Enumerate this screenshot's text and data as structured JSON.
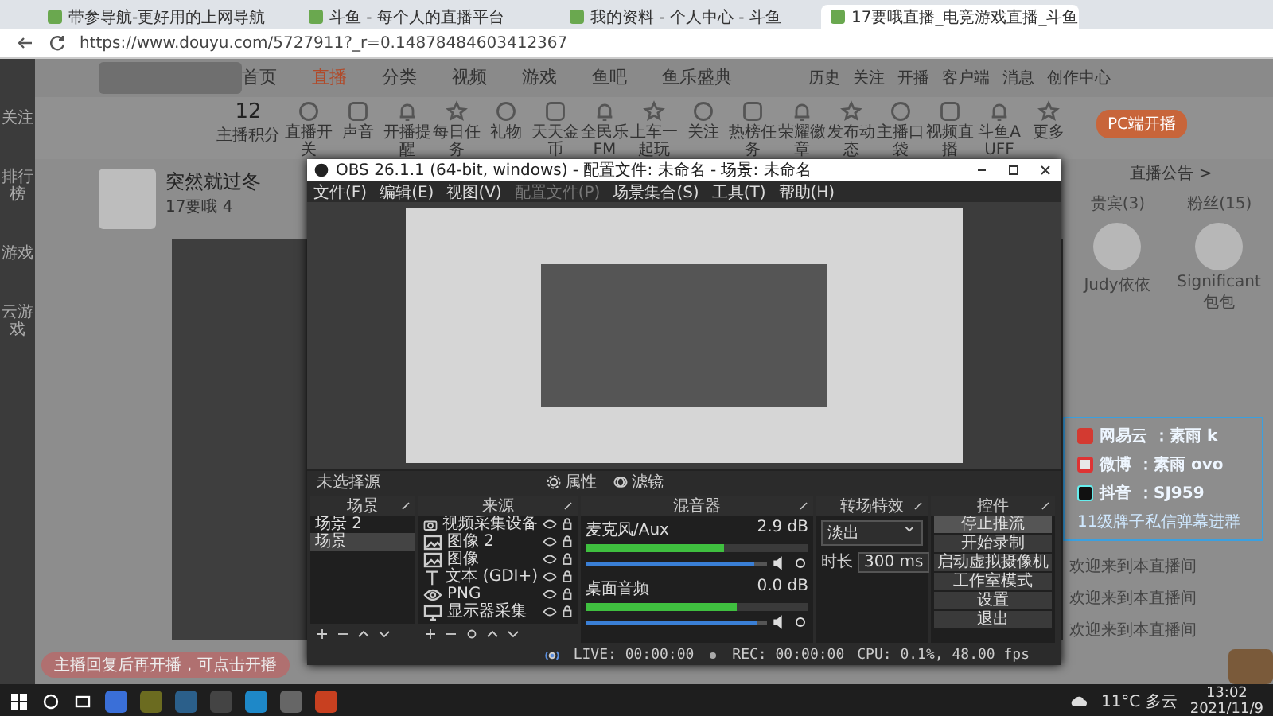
{
  "browser": {
    "tabs": [
      {
        "title": "带参导航-更好用的上网导航",
        "selected": false
      },
      {
        "title": "斗鱼 - 每个人的直播平台",
        "selected": false
      },
      {
        "title": "我的资料 - 个人中心 - 斗鱼",
        "selected": false
      },
      {
        "title": "17要哦直播_电竞游戏直播_斗鱼",
        "selected": true
      }
    ],
    "url": "https://www.douyu.com/5727911?_r=0.14878484603412367"
  },
  "site": {
    "nav": [
      {
        "label": "首页",
        "selected": false
      },
      {
        "label": "直播",
        "selected": true
      },
      {
        "label": "分类",
        "selected": false
      },
      {
        "label": "视频",
        "selected": false
      },
      {
        "label": "游戏",
        "selected": false
      },
      {
        "label": "鱼吧",
        "selected": false
      },
      {
        "label": "鱼乐盛典",
        "selected": false
      }
    ],
    "header_actions": [
      "历史",
      "关注",
      "开播",
      "客户端",
      "消息",
      "创作中心"
    ],
    "sidebar": [
      "关注",
      "排行榜",
      "游戏",
      "云游戏"
    ],
    "score": "12",
    "score_label": "主播积分",
    "tools": [
      "直播开关",
      "声音",
      "开播提醒",
      "每日任务",
      "礼物",
      "天天金币",
      "全民乐FM",
      "上车一起玩",
      "关注",
      "热榜任务",
      "荣耀徽章",
      "发布动态",
      "主播口袋",
      "视频直播",
      "斗鱼AUFF",
      "更多"
    ],
    "go_live_button": "PC端开播",
    "streamer": {
      "name": "突然就过冬",
      "room": "17要哦",
      "heat": "4"
    },
    "notice": "直播公告 >",
    "rank_tabs": [
      {
        "label": "贵宾(3)",
        "selected": false
      },
      {
        "label": "粉丝(15)",
        "selected": false
      }
    ],
    "top_users": [
      "Judy依依",
      "Significant包包"
    ],
    "chat": [
      "欢迎来到本直播间",
      "欢迎来到本直播间",
      "欢迎来到本直播间"
    ],
    "toast": "主播回复后再开播，可点击开播"
  },
  "overlay": {
    "lines": [
      {
        "platform": "网易云",
        "handle": "：素雨 k",
        "kind": "music"
      },
      {
        "platform": "微博",
        "handle": "：素雨 ovo",
        "kind": "weibo"
      },
      {
        "platform": "抖音",
        "handle": "：SJ959",
        "kind": "tiktok"
      }
    ],
    "caption": "11级牌子私信弹幕进群"
  },
  "obs": {
    "title": "OBS 26.1.1 (64-bit, windows) - 配置文件: 未命名 - 场景: 未命名",
    "menu": [
      {
        "label": "文件(F)",
        "disabled": false
      },
      {
        "label": "编辑(E)",
        "disabled": false
      },
      {
        "label": "视图(V)",
        "disabled": false
      },
      {
        "label": "配置文件(P)",
        "disabled": true
      },
      {
        "label": "场景集合(S)",
        "disabled": false
      },
      {
        "label": "工具(T)",
        "disabled": false
      },
      {
        "label": "帮助(H)",
        "disabled": false
      }
    ],
    "no_source": "未选择源",
    "properties": "属性",
    "filters": "滤镜",
    "docks": {
      "scenes": "场景",
      "sources": "来源",
      "mixer": "混音器",
      "transitions": "转场特效",
      "controls": "控件"
    },
    "scenes": [
      {
        "name": "场景 2",
        "selected": false
      },
      {
        "name": "场景",
        "selected": true
      }
    ],
    "sources": [
      {
        "name": "视频采集设备",
        "kind": "camera"
      },
      {
        "name": "图像 2",
        "kind": "image"
      },
      {
        "name": "图像",
        "kind": "image"
      },
      {
        "name": "文本 (GDI+)",
        "kind": "text"
      },
      {
        "name": "PNG",
        "kind": "media"
      },
      {
        "name": "显示器采集",
        "kind": "monitor"
      }
    ],
    "mixer": [
      {
        "name": "麦克风/Aux",
        "reading": "2.9 dB",
        "level": 0.62,
        "volume": {
          "level": 0.93
        }
      },
      {
        "name": "桌面音频",
        "reading": "0.0 dB",
        "level": 0.68,
        "volume": {
          "level": 0.95
        }
      }
    ],
    "transition": "淡出",
    "duration_label": "时长",
    "duration": "300 ms",
    "controls": [
      "停止推流",
      "开始录制",
      "启动虚拟摄像机",
      "工作室模式",
      "设置",
      "退出"
    ],
    "status": {
      "live": "LIVE: 00:00:00",
      "rec": "REC: 00:00:00",
      "cpu": "CPU: 0.1%, 48.00 fps"
    }
  },
  "taskbar": {
    "weather": "11°C 多云",
    "time": "13:02",
    "date": "2021/11/9"
  }
}
